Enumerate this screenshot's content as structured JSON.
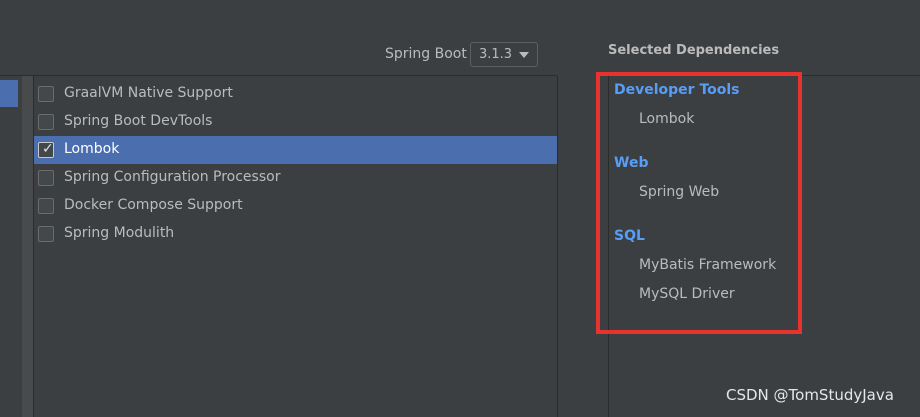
{
  "spring_boot": {
    "label": "Spring Boot",
    "version": "3.1.3"
  },
  "dependencies": [
    {
      "label": "GraalVM Native Support",
      "checked": false
    },
    {
      "label": "Spring Boot DevTools",
      "checked": false
    },
    {
      "label": "Lombok",
      "checked": true
    },
    {
      "label": "Spring Configuration Processor",
      "checked": false
    },
    {
      "label": "Docker Compose Support",
      "checked": false
    },
    {
      "label": "Spring Modulith",
      "checked": false
    }
  ],
  "selected_dependencies": {
    "title": "Selected Dependencies",
    "groups": [
      {
        "name": "Developer Tools",
        "items": [
          "Lombok"
        ]
      },
      {
        "name": "Web",
        "items": [
          "Spring Web"
        ]
      },
      {
        "name": "SQL",
        "items": [
          "MyBatis Framework",
          "MySQL Driver"
        ]
      }
    ]
  },
  "check_glyph": "✓",
  "colors": {
    "background": "#3c3f41",
    "selection": "#4b6eaf",
    "group_title": "#589df6",
    "highlight_box": "#e8322e"
  },
  "watermark": "CSDN @TomStudyJava"
}
